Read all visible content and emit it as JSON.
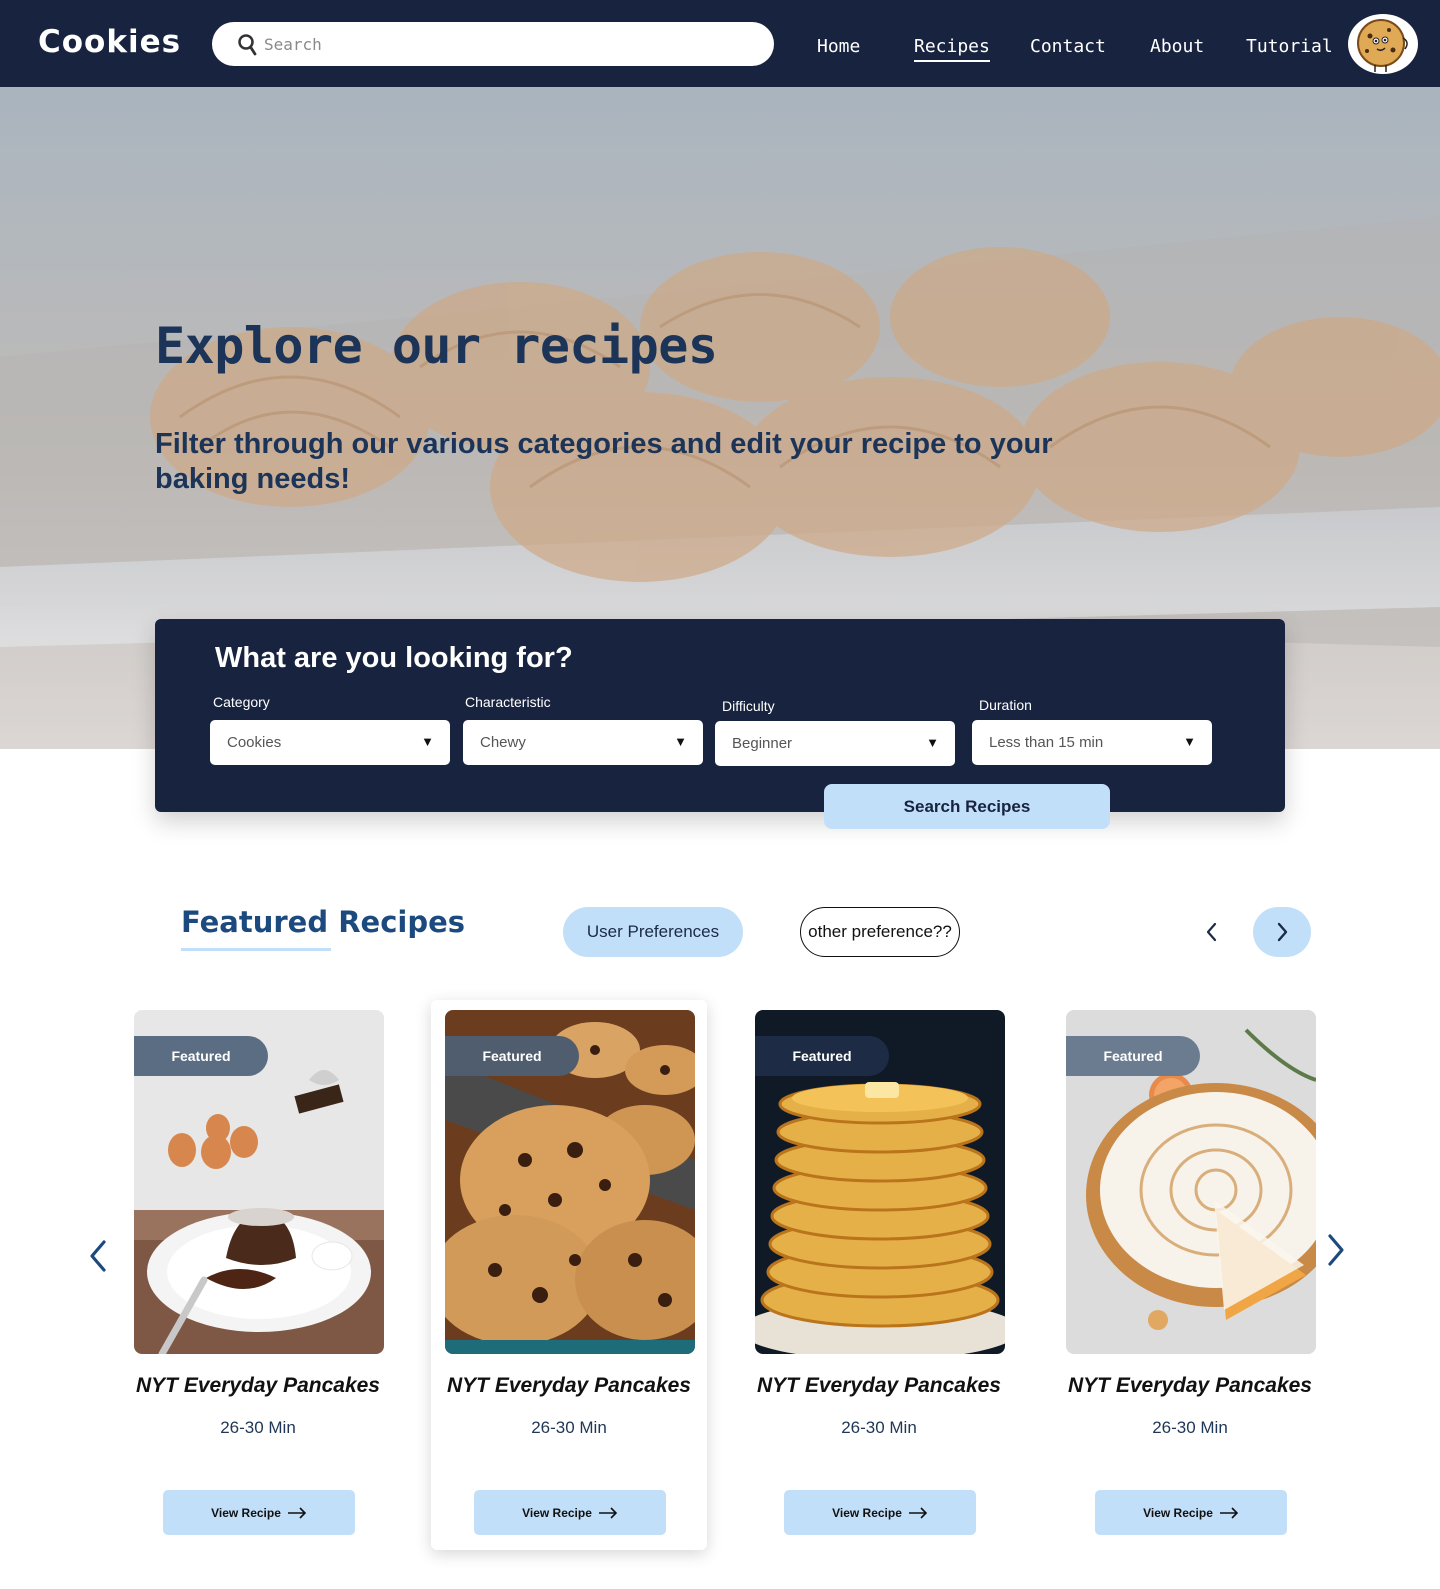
{
  "brand": {
    "logo": "Cookies"
  },
  "header": {
    "search_placeholder": "Search",
    "nav": [
      "Home",
      "Recipes",
      "Contact",
      "About",
      "Tutorial"
    ],
    "active_nav": "Recipes"
  },
  "hero": {
    "title": "Explore our recipes",
    "subtitle": "Filter through our various categories and edit your recipe to your baking needs!"
  },
  "filter": {
    "title": "What are you looking for?",
    "fields": [
      {
        "label": "Category",
        "value": "Cookies"
      },
      {
        "label": "Characteristic",
        "value": "Chewy"
      },
      {
        "label": "Difficulty",
        "value": "Beginner"
      },
      {
        "label": "Duration",
        "value": "Less than 15 min"
      }
    ],
    "search_button": "Search Recipes"
  },
  "featured": {
    "title": "Featured Recipes",
    "pill_primary": "User Preferences",
    "pill_secondary": "other preference??",
    "cards": [
      {
        "badge": "Featured",
        "title": "NYT Everyday Pancakes",
        "duration": "26-30 Min",
        "button": "View Recipe"
      },
      {
        "badge": "Featured",
        "title": "NYT Everyday Pancakes",
        "duration": "26-30 Min",
        "button": "View Recipe"
      },
      {
        "badge": "Featured",
        "title": "NYT Everyday Pancakes",
        "duration": "26-30 Min",
        "button": "View Recipe"
      },
      {
        "badge": "Featured",
        "title": "NYT Everyday Pancakes",
        "duration": "26-30 Min",
        "button": "View Recipe"
      }
    ]
  },
  "colors": {
    "navy": "#18243f",
    "accent_light_blue": "#c2dffa",
    "heading_blue": "#1c4a7e"
  },
  "icons": [
    "search-icon",
    "cookie-mascot-icon",
    "chevron-left-icon",
    "chevron-right-icon",
    "arrow-right-icon"
  ]
}
